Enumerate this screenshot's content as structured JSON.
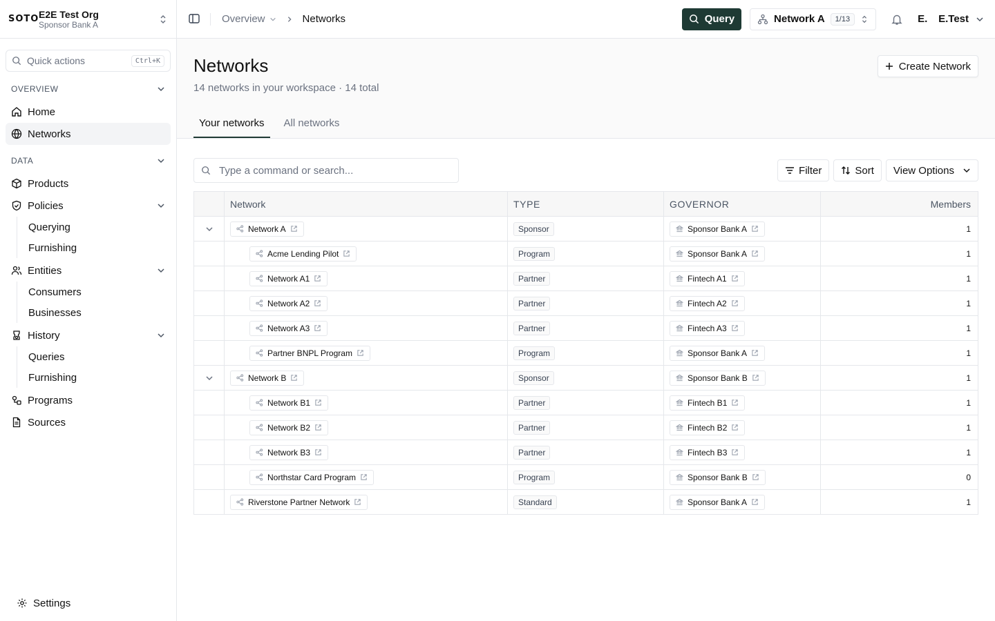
{
  "org": {
    "logo": "SOTO",
    "name": "E2E Test Org",
    "sub": "Sponsor Bank A"
  },
  "quick_actions": {
    "label": "Quick actions",
    "shortcut": "Ctrl+K"
  },
  "sidebar": {
    "overview_label": "OVERVIEW",
    "home": "Home",
    "networks": "Networks",
    "data_label": "DATA",
    "products": "Products",
    "policies": "Policies",
    "querying": "Querying",
    "furnishing": "Furnishing",
    "entities": "Entities",
    "consumers": "Consumers",
    "businesses": "Businesses",
    "history": "History",
    "queries": "Queries",
    "history_furnishing": "Furnishing",
    "programs": "Programs",
    "sources": "Sources",
    "settings": "Settings"
  },
  "breadcrumb": {
    "parent": "Overview",
    "current": "Networks"
  },
  "topbar": {
    "query_label": "Query",
    "network_name": "Network A",
    "network_count": "1/13",
    "user_initial": "E.",
    "user_name": "E.Test"
  },
  "page": {
    "title": "Networks",
    "subtitle": "14 networks in your workspace · 14 total",
    "create_label": "Create Network",
    "tab_your": "Your networks",
    "tab_all": "All networks"
  },
  "toolbar": {
    "search_placeholder": "Type a command or search...",
    "filter_label": "Filter",
    "sort_label": "Sort",
    "view_label": "View Options"
  },
  "table": {
    "headers": {
      "network": "Network",
      "type": "TYPE",
      "governor": "GOVERNOR",
      "members": "Members"
    },
    "rows": [
      {
        "network": "Network A",
        "type": "Sponsor",
        "governor": "Sponsor Bank A",
        "members": "1",
        "level": 0,
        "expandable": true
      },
      {
        "network": "Acme Lending Pilot",
        "type": "Program",
        "governor": "Sponsor Bank A",
        "members": "1",
        "level": 1,
        "expandable": false
      },
      {
        "network": "Network A1",
        "type": "Partner",
        "governor": "Fintech A1",
        "members": "1",
        "level": 1,
        "expandable": false
      },
      {
        "network": "Network A2",
        "type": "Partner",
        "governor": "Fintech A2",
        "members": "1",
        "level": 1,
        "expandable": false
      },
      {
        "network": "Network A3",
        "type": "Partner",
        "governor": "Fintech A3",
        "members": "1",
        "level": 1,
        "expandable": false
      },
      {
        "network": "Partner BNPL Program",
        "type": "Program",
        "governor": "Sponsor Bank A",
        "members": "1",
        "level": 1,
        "expandable": false
      },
      {
        "network": "Network B",
        "type": "Sponsor",
        "governor": "Sponsor Bank B",
        "members": "1",
        "level": 0,
        "expandable": true
      },
      {
        "network": "Network B1",
        "type": "Partner",
        "governor": "Fintech B1",
        "members": "1",
        "level": 1,
        "expandable": false
      },
      {
        "network": "Network B2",
        "type": "Partner",
        "governor": "Fintech B2",
        "members": "1",
        "level": 1,
        "expandable": false
      },
      {
        "network": "Network B3",
        "type": "Partner",
        "governor": "Fintech B3",
        "members": "1",
        "level": 1,
        "expandable": false
      },
      {
        "network": "Northstar Card Program",
        "type": "Program",
        "governor": "Sponsor Bank B",
        "members": "0",
        "level": 1,
        "expandable": false
      },
      {
        "network": "Riverstone Partner Network",
        "type": "Standard",
        "governor": "Sponsor Bank A",
        "members": "1",
        "level": 0,
        "expandable": false
      }
    ]
  },
  "colors": {
    "accent": "#1e3a34",
    "border": "#e5e7eb",
    "muted": "#6b7280"
  },
  "icons": [
    "chevrons-up-down-icon",
    "search-icon",
    "home-icon",
    "globe-icon",
    "package-icon",
    "shield-icon",
    "users-icon",
    "history-icon",
    "programs-icon",
    "file-icon",
    "gear-icon",
    "panel-icon",
    "bell-icon",
    "plus-icon",
    "filter-icon",
    "sort-icon",
    "share-icon",
    "external-link-icon",
    "bank-icon",
    "chevron-down-icon"
  ]
}
